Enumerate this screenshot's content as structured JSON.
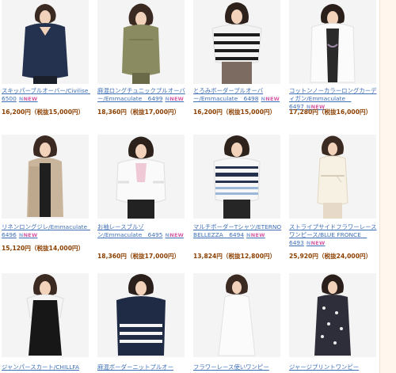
{
  "products": [
    {
      "name": "スキッパーブルオーバー/Civilise　6500",
      "new": "NEW",
      "price": "16,200円（税抜15,000円）",
      "img": "dress-navy-icon"
    },
    {
      "name": "麻混ロングチュニックプルオーバー/Emmaculate　6499",
      "new": "NEW",
      "price": "18,360円（税抜17,000円）",
      "img": "tunic-olive-icon"
    },
    {
      "name": "とろみボーダープルオーバー/Emmaculate　6498",
      "new": "NEW",
      "price": "16,200円（税抜15,000円）",
      "img": "striped-top-icon"
    },
    {
      "name": "コットンノーカラーロングカーディガン/Emmaculate　6497",
      "new": "NEW",
      "price": "17,280円（税抜16,000円）",
      "img": "white-cardigan-icon"
    },
    {
      "name": "リネンロングジレ/Emmaculate　6496",
      "new": "NEW",
      "price": "15,120円（税抜14,000円）",
      "img": "beige-gilet-icon"
    },
    {
      "name": "お袖レースブルゾン/Emmaculate　6495",
      "new": "NEW",
      "price": "18,360円（税抜17,000円）",
      "img": "white-blouson-icon"
    },
    {
      "name": "マルチボーダーTシャツ/ETERNO BELLEZZA　6494",
      "new": "NEW",
      "price": "13,824円（税抜12,800円）",
      "img": "multi-border-tshirt-icon"
    },
    {
      "name": "ストライプサイドフラワーレースワンピース/BLUE FRONCE　6493",
      "new": "NEW",
      "price": "25,920円（税抜24,000円）",
      "img": "white-lace-dress-icon"
    },
    {
      "name": "ジャンパースカート/CHILLFA",
      "new": "",
      "price": "",
      "img": "black-jumper-skirt-icon"
    },
    {
      "name": "麻混ボーダーニットプルオー",
      "new": "",
      "price": "",
      "img": "striped-knit-icon"
    },
    {
      "name": "フラワーレース使いワンピー",
      "new": "",
      "price": "",
      "img": "white-dress-icon"
    },
    {
      "name": "ジャージプリントワンピー",
      "new": "",
      "price": "",
      "img": "print-dress-icon"
    }
  ]
}
